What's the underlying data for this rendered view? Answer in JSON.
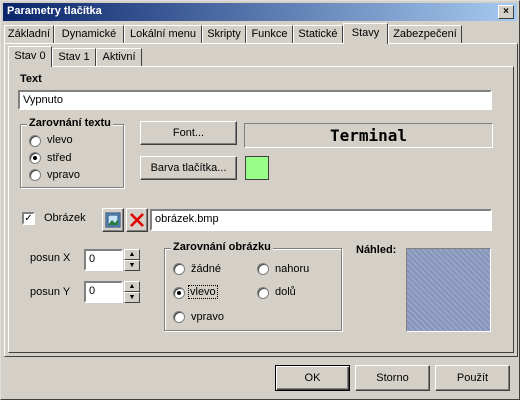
{
  "window": {
    "title": "Parametry tlačítka",
    "close_glyph": "×"
  },
  "tabs": [
    "Základní",
    "Dynamické",
    "Lokální menu",
    "Skripty",
    "Funkce",
    "Statické",
    "Stavy",
    "Zabezpečení"
  ],
  "active_tab": "Stavy",
  "subtabs": [
    "Stav 0",
    "Stav 1",
    "Aktivní"
  ],
  "active_subtab": "Stav 0",
  "text_section": {
    "label": "Text",
    "value": "Vypnuto"
  },
  "text_alignment": {
    "title": "Zarovnání textu",
    "options": [
      "vlevo",
      "střed",
      "vpravo"
    ],
    "selected": "střed"
  },
  "font_button": "Font...",
  "font_preview": "Terminal",
  "button_color": {
    "label": "Barva tlačítka...",
    "swatch": "#99ff88"
  },
  "image": {
    "label": "Obrázek",
    "checked": true,
    "filename": "obrázek.bmp",
    "browse_icon": "image-icon",
    "delete_icon": "red-x-icon"
  },
  "offset_x": {
    "label": "posun X",
    "value": "0"
  },
  "offset_y": {
    "label": "posun Y",
    "value": "0"
  },
  "image_alignment": {
    "title": "Zarovnání obrázku",
    "options": [
      "žádné",
      "nahoru",
      "vlevo",
      "dolů",
      "vpravo"
    ],
    "selected": "vlevo"
  },
  "preview_label": "Náhled:",
  "dialog_buttons": {
    "ok": "OK",
    "cancel": "Storno",
    "apply": "Použít"
  },
  "colors": {
    "titlebar_start": "#0a246a",
    "titlebar_end": "#a6caf0",
    "face": "#d4d0c8",
    "preview_fill": "#8e9dc4"
  }
}
